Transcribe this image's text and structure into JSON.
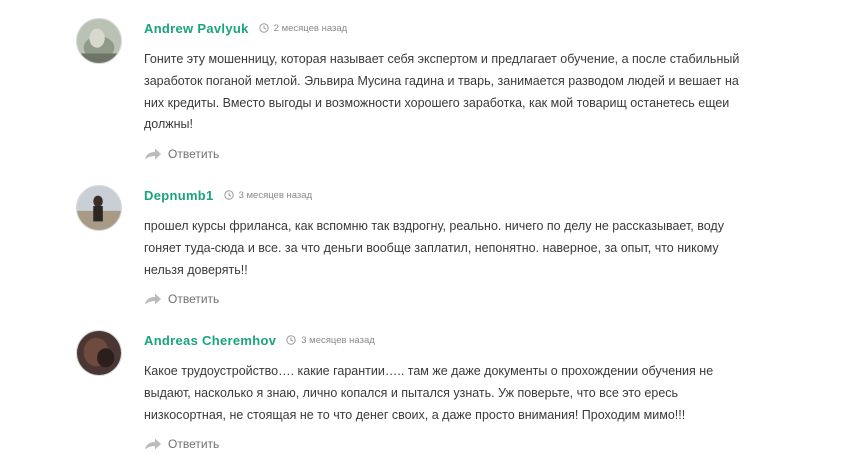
{
  "comments": [
    {
      "author": "Andrew Pavlyuk",
      "date": "2 месяцев назад",
      "text": "Гоните эту мошенницу, которая называет себя экспертом и предлагает обучение, а после стабильный заработок поганой метлой. Эльвира Мусина гадина и тварь, занимается разводом людей и вешает на них кредиты. Вместо выгоды и возможности хорошего заработка, как мой товарищ останетесь ещеи должны!",
      "reply_label": "Ответить"
    },
    {
      "author": "Depnumb1",
      "date": "3 месяцев назад",
      "text": "прошел курсы фриланса, как вспомню так вздрогну, реально. ничего по делу не рассказывает, воду гоняет туда-сюда и все. за что деньги вообще заплатил, непонятно. наверное, за опыт, что никому нельзя доверять!!",
      "reply_label": "Ответить"
    },
    {
      "author": "Andreas Cheremhov",
      "date": "3 месяцев назад",
      "text": "Какое трудоустройство…. какие гарантии….. там же даже документы о прохождении обучения не выдают, насколько я знаю, лично копался и пытался узнать. Уж поверьте, что все это ересь низкосортная, не стоящая не то что денег своих, а даже просто внимания! Проходим мимо!!!",
      "reply_label": "Ответить"
    }
  ],
  "colors": {
    "author": "#1aa37f",
    "date": "#8a8a8a",
    "text": "#3a3a3a",
    "reply": "#707070"
  },
  "icons": {
    "date": "clock-icon",
    "reply": "reply-arrow-icon"
  }
}
